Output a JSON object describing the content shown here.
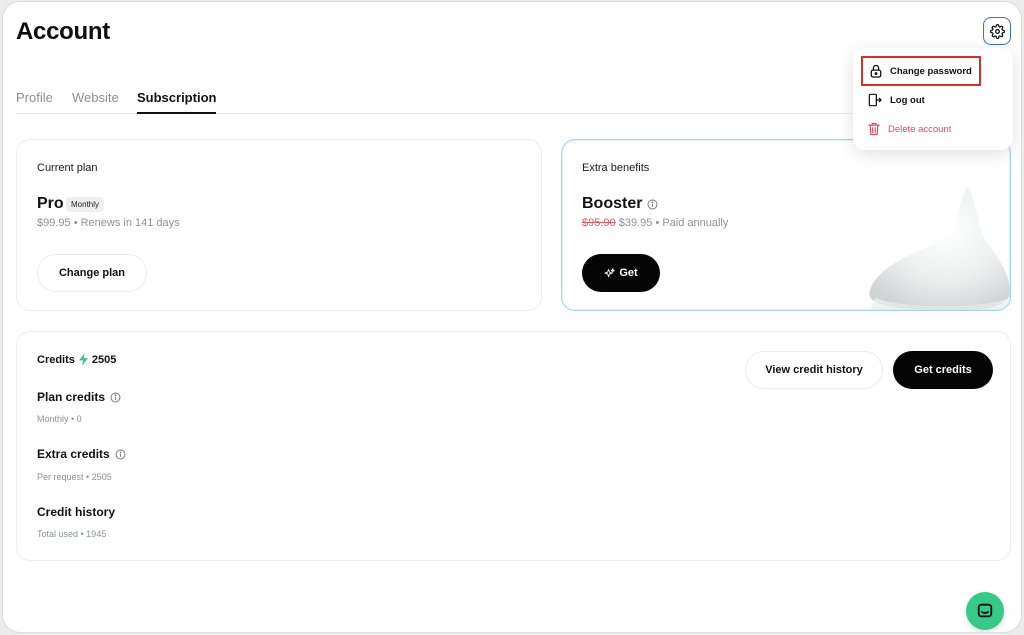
{
  "page": {
    "title": "Account"
  },
  "tabs": [
    {
      "label": "Profile",
      "active": false
    },
    {
      "label": "Website",
      "active": false
    },
    {
      "label": "Subscription",
      "active": true
    }
  ],
  "current_plan": {
    "label": "Current plan",
    "name": "Pro",
    "billing_badge": "Monthly",
    "price_line": "$99.95 • Renews in 141 days",
    "button": "Change plan"
  },
  "extra_benefits": {
    "label": "Extra benefits",
    "name": "Booster",
    "old_price": "$95.90",
    "price_line": " $39.95 • Paid annually",
    "button": "Get"
  },
  "credits": {
    "label": "Credits",
    "total": "2505",
    "view_history_button": "View credit history",
    "get_credits_button": "Get credits",
    "sections": [
      {
        "title": "Plan credits",
        "sub": "Monthly • 0",
        "info": true
      },
      {
        "title": "Extra credits",
        "sub": "Per request • 2505",
        "info": true
      },
      {
        "title": "Credit history",
        "sub": "Total used • 1945",
        "info": false
      }
    ]
  },
  "settings_menu": {
    "items": [
      {
        "label": "Change password",
        "icon": "lock-icon"
      },
      {
        "label": "Log out",
        "icon": "logout-icon"
      },
      {
        "label": "Delete account",
        "icon": "trash-icon"
      }
    ]
  },
  "colors": {
    "accent_green": "#35c98a",
    "danger": "#e04a5f",
    "highlight_border": "#d62f2f",
    "settings_border": "#3d6fd6"
  }
}
